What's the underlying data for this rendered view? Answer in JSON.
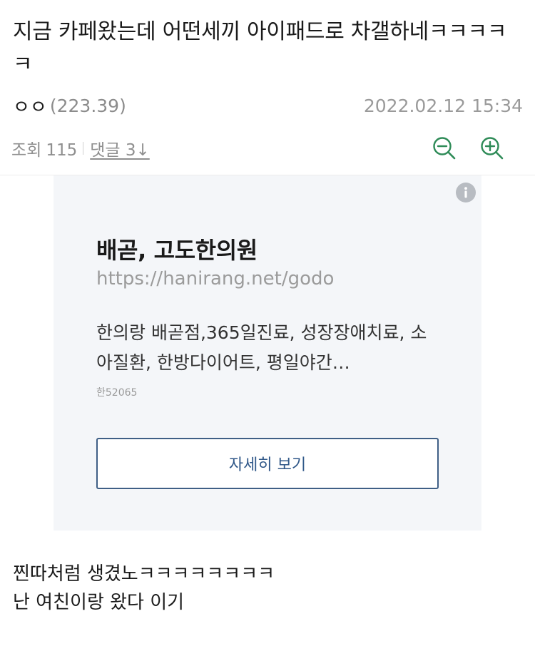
{
  "post": {
    "title": "지금 카페왔는데 어떤세끼 아이패드로 차갤하네ㅋㅋㅋㅋㅋ",
    "author": "ㅇㅇ",
    "author_ip": "(223.39)",
    "date": "2022.02.12 15:34",
    "views_label": "조회",
    "views_count": "115",
    "comments_link": "댓글 3↓",
    "body_lines": [
      "찐따처럼 생겼노ㅋㅋㅋㅋㅋㅋㅋㅋ",
      "난 여친이랑 왔다 이기"
    ]
  },
  "toolbar": {
    "zoom_out_icon": "zoom-out-icon",
    "zoom_in_icon": "zoom-in-icon",
    "accent_color": "#2e8b57"
  },
  "ad": {
    "info_icon": "info-icon",
    "title": "배곧, 고도한의원",
    "url": "https://hanirang.net/godo",
    "description": "한의랑 배곧점,365일진료, 성장장애치료, 소아질환, 한방다이어트, 평일야간…",
    "code": "한52065",
    "button_label": "자세히 보기",
    "background_color": "#f4f6f9",
    "button_color": "#2f5788"
  }
}
